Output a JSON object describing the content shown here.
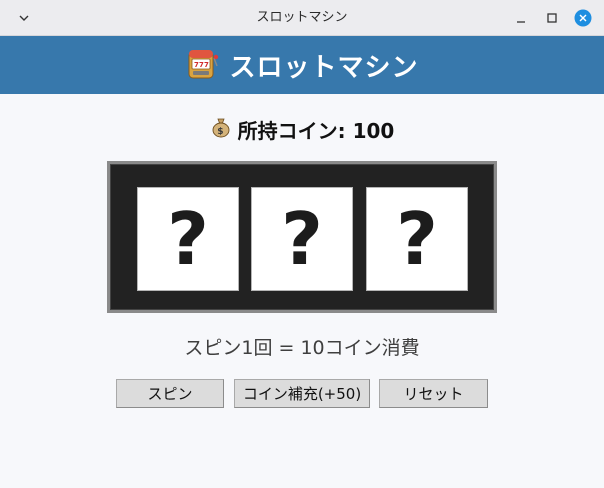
{
  "window": {
    "title": "スロットマシン",
    "menu_icon": "chevron-down-icon",
    "controls": [
      "minimize-icon",
      "maximize-icon",
      "close-icon"
    ],
    "close_color": "#1e8ee0"
  },
  "header": {
    "icon": "slot-machine-icon",
    "title": "スロットマシン",
    "background": "#3778ac"
  },
  "coins": {
    "icon": "money-bag-icon",
    "label": "所持コイン: 100"
  },
  "reels": [
    "?",
    "?",
    "?"
  ],
  "cost_text": "スピン1回 = 10コイン消費",
  "buttons": {
    "spin": "スピン",
    "refill": "コイン補充(+50)",
    "reset": "リセット"
  }
}
